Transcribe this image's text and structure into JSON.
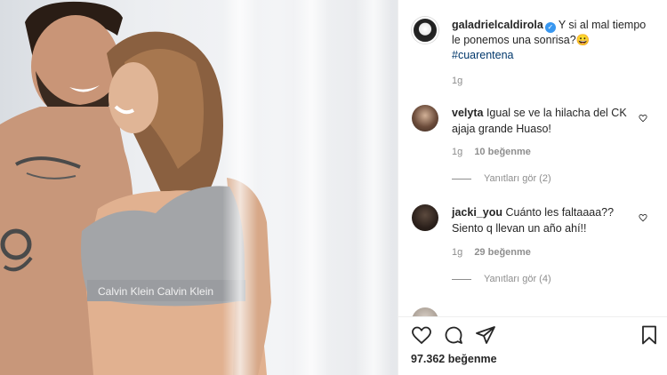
{
  "post": {
    "username": "galadrielcaldirola",
    "caption": "Y si al mal tiempo le ponemos una sonrisa?",
    "caption_emoji": "😀",
    "hashtag": "#cuarentena",
    "time": "1g",
    "likes_label": "97.362 beğenme"
  },
  "comments": [
    {
      "username": "velyta",
      "text": "Igual se ve la hilacha del CK ajaja grande Huaso!",
      "time": "1g",
      "likes": "10 beğenme",
      "replies": "Yanıtları gör (2)"
    },
    {
      "username": "jacki_you",
      "text": "Cuánto les faltaaaa?? Siento q llevan un año ahí!!",
      "time": "1g",
      "likes": "29 beğenme",
      "replies": "Yanıtları gör (4)"
    }
  ],
  "photo": {
    "waistband_text": "Calvin Klein  Calvin Klein"
  },
  "icons": {
    "like": "heart-icon",
    "comment": "comment-icon",
    "share": "share-icon",
    "save": "bookmark-icon"
  },
  "colors": {
    "link": "#00376b",
    "verified": "#3897f0",
    "muted": "#8e8e8e"
  }
}
